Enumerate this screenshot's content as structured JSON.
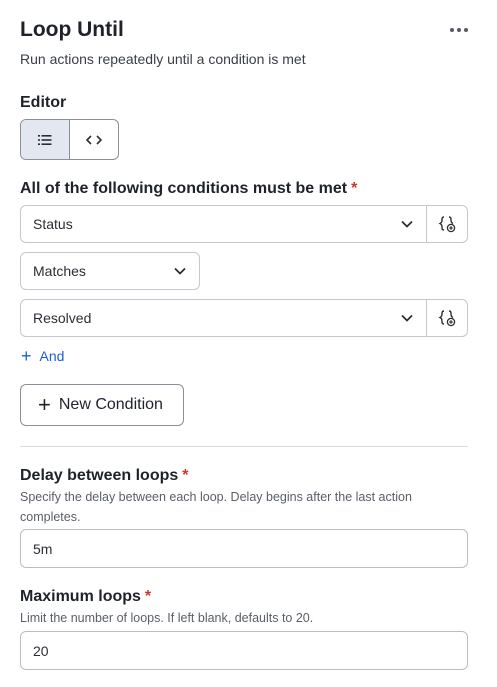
{
  "header": {
    "title": "Loop Until",
    "subtitle": "Run actions repeatedly until a condition is met"
  },
  "editor": {
    "label": "Editor",
    "modes": [
      "list",
      "code"
    ],
    "active_mode": "list"
  },
  "conditions": {
    "label": "All of the following conditions must be met",
    "required_mark": "*",
    "field_value": "Status",
    "operator_value": "Matches",
    "compare_value": "Resolved",
    "and_label": "And",
    "new_condition_label": "New Condition"
  },
  "delay": {
    "label": "Delay between loops",
    "required_mark": "*",
    "help": "Specify the delay between each loop. Delay begins after the last action completes.",
    "value": "5m"
  },
  "max_loops": {
    "label": "Maximum loops",
    "required_mark": "*",
    "help": "Limit the number of loops. If left blank, defaults to 20.",
    "value": "20"
  },
  "colors": {
    "accent": "#1d5fd0",
    "required": "#d0342c",
    "active_segment": "#e3e7ef"
  },
  "icons": [
    "more-icon",
    "list-icon",
    "code-icon",
    "chevron-down-icon",
    "variable-icon",
    "plus-icon"
  ]
}
